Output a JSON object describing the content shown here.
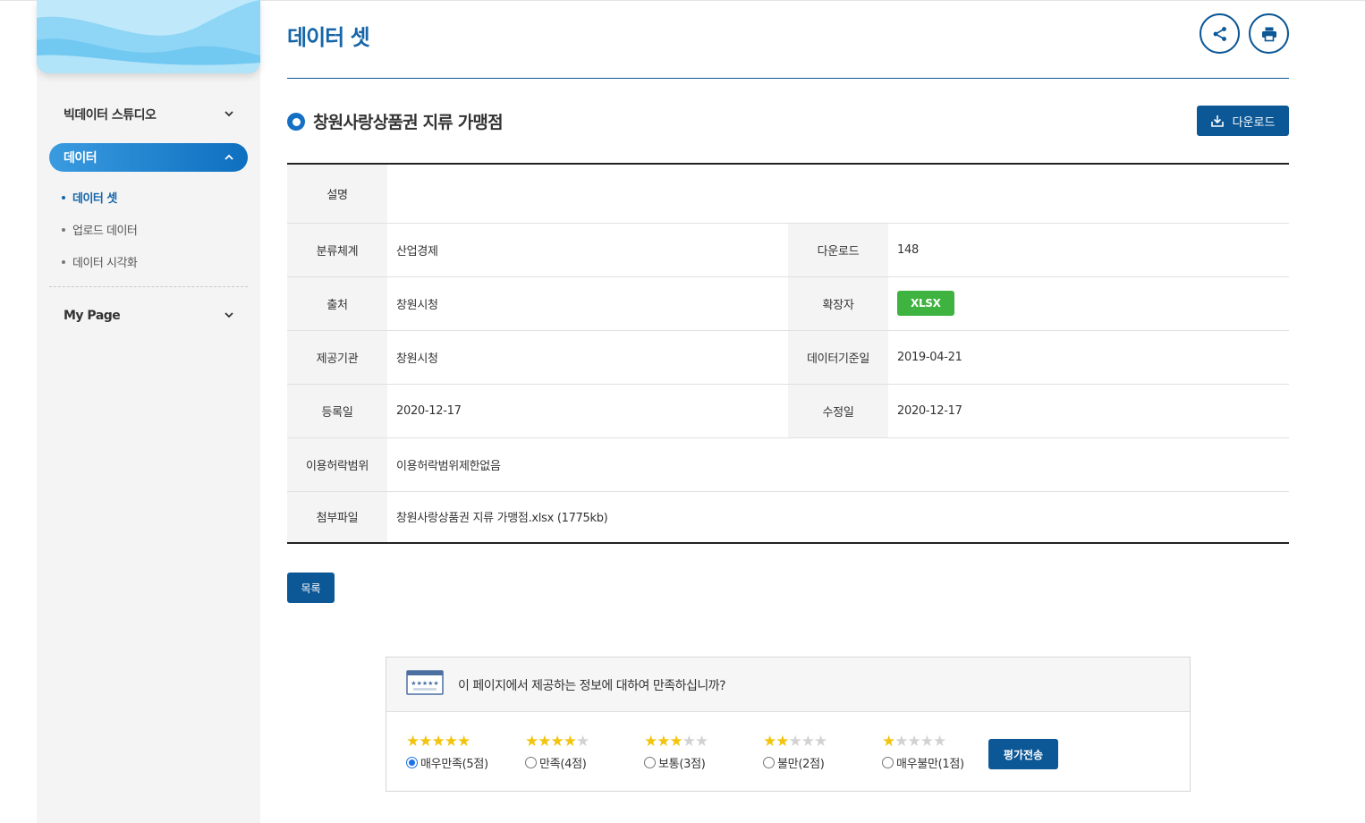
{
  "sidebar": {
    "menu": [
      {
        "label": "빅데이터 스튜디오",
        "expanded": false
      },
      {
        "label": "데이터",
        "expanded": true
      },
      {
        "label": "My Page",
        "expanded": false
      }
    ],
    "submenu": [
      {
        "label": "데이터 셋",
        "current": true
      },
      {
        "label": "업로드 데이터",
        "current": false
      },
      {
        "label": "데이터 시각화",
        "current": false
      }
    ]
  },
  "page": {
    "title": "데이터 셋"
  },
  "dataset": {
    "title": "창원사랑상품권 지류 가맹점",
    "download_label": "다운로드",
    "fields": {
      "desc": {
        "label": "설명",
        "value": ""
      },
      "category": {
        "label": "분류체계",
        "value": "산업경제"
      },
      "downloads": {
        "label": "다운로드",
        "value": "148"
      },
      "source": {
        "label": "출처",
        "value": "창원시청"
      },
      "extension": {
        "label": "확장자",
        "value": "XLSX"
      },
      "provider": {
        "label": "제공기관",
        "value": "창원시청"
      },
      "base_date": {
        "label": "데이터기준일",
        "value": "2019-04-21"
      },
      "reg_date": {
        "label": "등록일",
        "value": "2020-12-17"
      },
      "mod_date": {
        "label": "수정일",
        "value": "2020-12-17"
      },
      "license": {
        "label": "이용허락범위",
        "value": "이용허락범위제한없음"
      },
      "attachment": {
        "label": "첨부파일",
        "value": "창원사랑상품권 지류 가맹점.xlsx (1775kb)"
      }
    },
    "list_label": "목록"
  },
  "survey": {
    "question": "이 페이지에서 제공하는 정보에 대하여 만족하십니까?",
    "options": [
      {
        "label": "매우만족(5점)",
        "stars": 5,
        "selected": true
      },
      {
        "label": "만족(4점)",
        "stars": 4,
        "selected": false
      },
      {
        "label": "보통(3점)",
        "stars": 3,
        "selected": false
      },
      {
        "label": "불만(2점)",
        "stars": 2,
        "selected": false
      },
      {
        "label": "매우불만(1점)",
        "stars": 1,
        "selected": false
      }
    ],
    "submit_label": "평가전송"
  },
  "colors": {
    "primary": "#0c5796",
    "accent": "#1570c4",
    "badge": "#3fb33f",
    "star": "#f2c40e"
  },
  "icons": [
    "chevron-down-icon",
    "chevron-up-icon",
    "share-icon",
    "print-icon",
    "download-icon",
    "survey-icon"
  ]
}
